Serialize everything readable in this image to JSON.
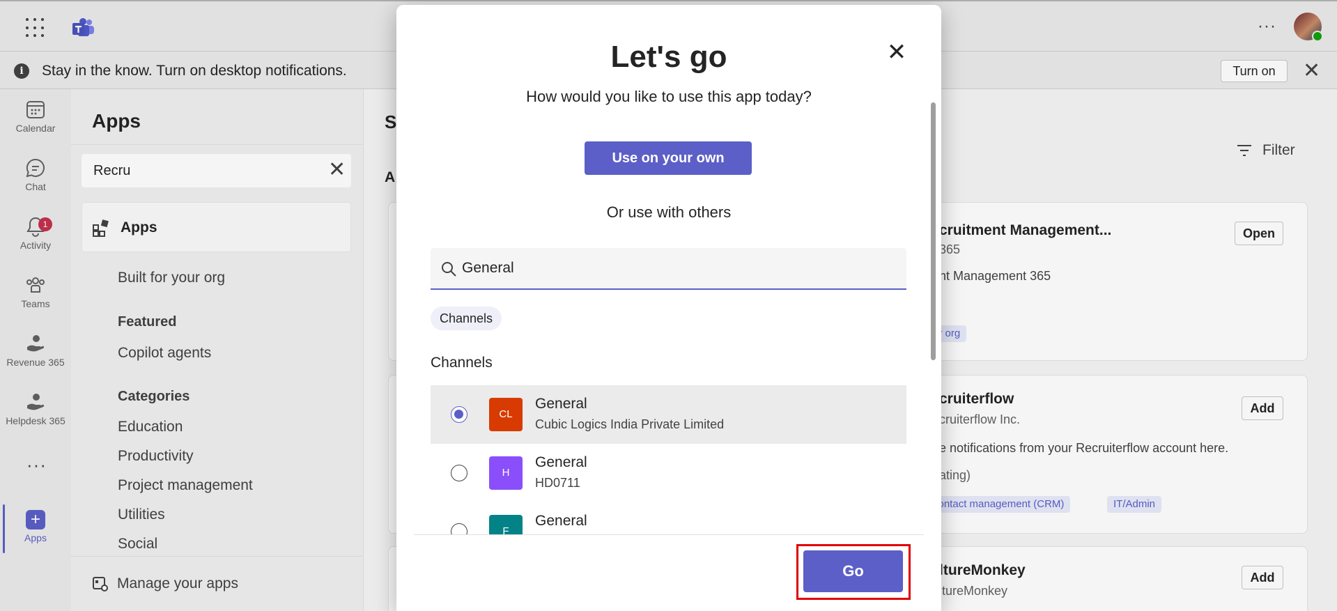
{
  "notification": {
    "message": "Stay in the know. Turn on desktop notifications.",
    "turn_on_label": "Turn on"
  },
  "rail": {
    "items": [
      {
        "label": "Calendar"
      },
      {
        "label": "Chat"
      },
      {
        "label": "Activity",
        "badge": "1"
      },
      {
        "label": "Teams"
      },
      {
        "label": "Revenue 365"
      },
      {
        "label": "Helpdesk 365"
      },
      {
        "label": "Apps"
      }
    ]
  },
  "left_pane": {
    "title": "Apps",
    "search_value": "Recru",
    "apps_label": "Apps",
    "built_for_org": "Built for your org",
    "featured": "Featured",
    "copilot_agents": "Copilot agents",
    "categories": "Categories",
    "category_items": [
      "Education",
      "Productivity",
      "Project management",
      "Utilities",
      "Social"
    ],
    "manage_apps": "Manage your apps"
  },
  "main": {
    "heading_partial": "S",
    "section_partial": "A",
    "filter_label": "Filter",
    "cards": [
      {
        "name": "cruitment Management...",
        "publisher": "365",
        "desc": "nt Management 365",
        "tag": "ur org",
        "button": "Open"
      },
      {
        "name": "cruiterflow",
        "publisher": "cruiterflow Inc.",
        "desc": "e notifications from your Recruiterflow account here.",
        "sub": "ating)",
        "tags": [
          "contact management (CRM)",
          "IT/Admin"
        ],
        "button": "Add"
      },
      {
        "name": "ltureMonkey",
        "publisher": "ltureMonkey",
        "button": "Add"
      }
    ]
  },
  "dialog": {
    "title": "Let's go",
    "subtitle": "How would you like to use this app today?",
    "use_own_label": "Use on your own",
    "or_label": "Or use with others",
    "search_value": "General",
    "chip_label": "Channels",
    "section_label": "Channels",
    "channels": [
      {
        "initials": "CL",
        "name": "General",
        "team": "Cubic Logics India Private Limited",
        "color": "#d83b01",
        "selected": true
      },
      {
        "initials": "H",
        "name": "General",
        "team": "HD0711",
        "color": "#8a4ffa",
        "selected": false
      },
      {
        "initials": "F",
        "name": "General",
        "team": "",
        "color": "#038387",
        "selected": false
      }
    ],
    "go_label": "Go"
  },
  "colors": {
    "accent": "#5b5fc7",
    "highlight": "#e00000"
  }
}
